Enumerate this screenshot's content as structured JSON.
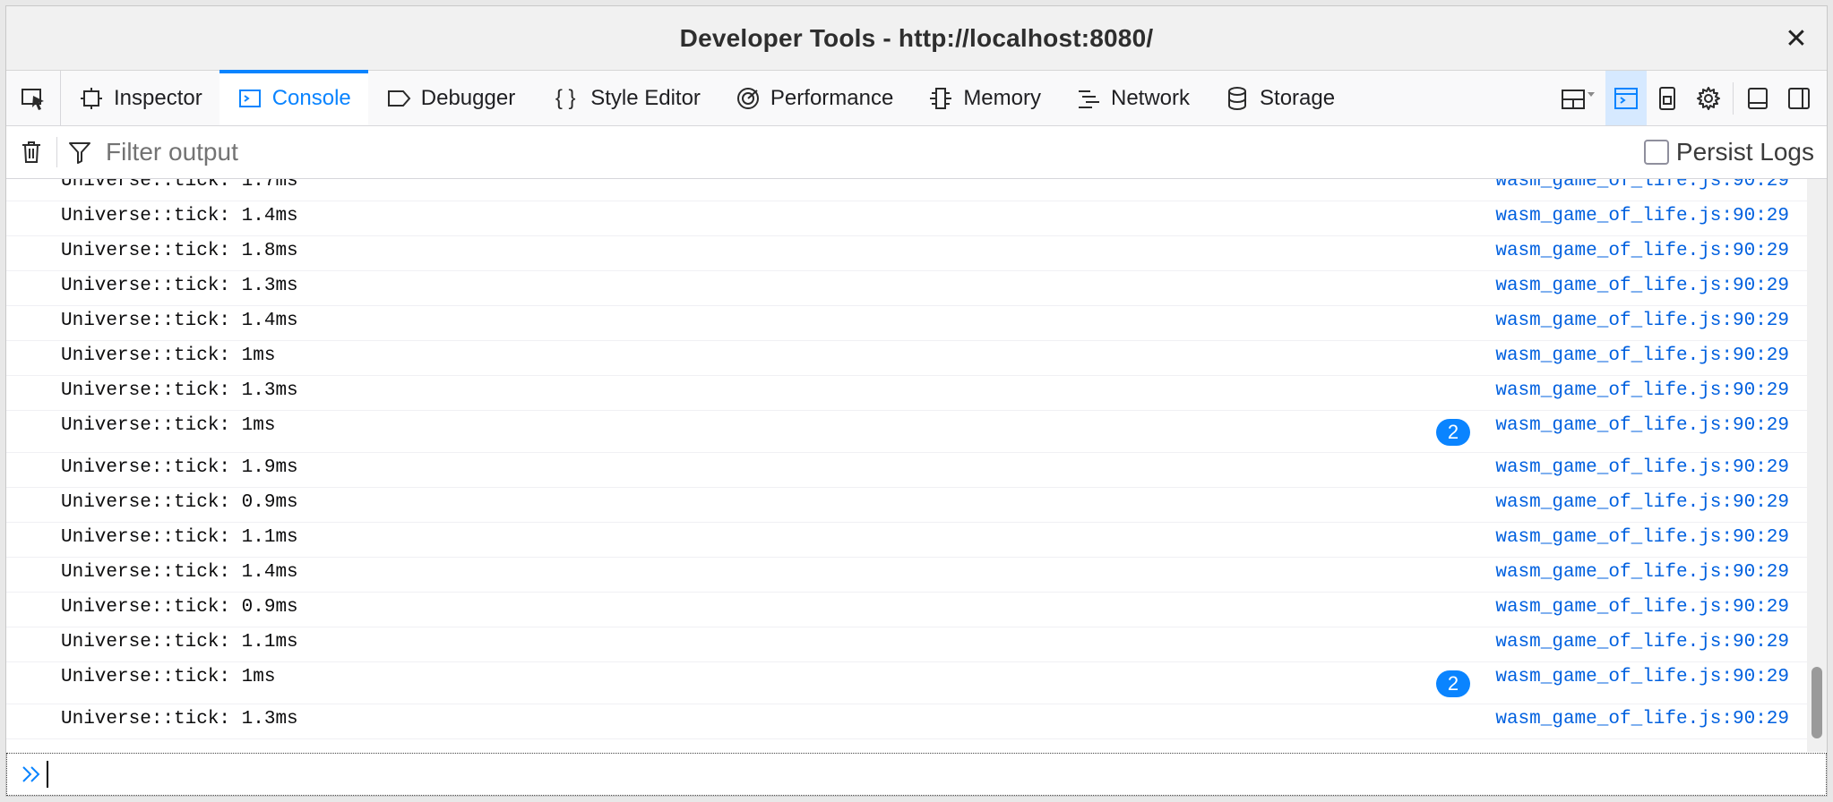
{
  "window": {
    "title": "Developer Tools - http://localhost:8080/",
    "close_glyph": "✕"
  },
  "toolbar": {
    "tabs": [
      {
        "label": "Inspector",
        "icon": "inspector-icon"
      },
      {
        "label": "Console",
        "icon": "console-icon",
        "selected": true
      },
      {
        "label": "Debugger",
        "icon": "debugger-icon"
      },
      {
        "label": "Style Editor",
        "icon": "style-editor-icon"
      },
      {
        "label": "Performance",
        "icon": "performance-icon"
      },
      {
        "label": "Memory",
        "icon": "memory-icon"
      },
      {
        "label": "Network",
        "icon": "network-icon"
      },
      {
        "label": "Storage",
        "icon": "storage-icon"
      }
    ],
    "style_editor_glyph": "{ }",
    "accent_color": "#0a84ff"
  },
  "filter": {
    "placeholder": "Filter output",
    "value": "",
    "persist_logs_label": "Persist Logs",
    "persist_logs_checked": false
  },
  "console": {
    "messages": [
      {
        "text": "Universe::tick: 1.7ms",
        "source": "wasm_game_of_life.js:90:29"
      },
      {
        "text": "Universe::tick: 1.4ms",
        "source": "wasm_game_of_life.js:90:29"
      },
      {
        "text": "Universe::tick: 1.8ms",
        "source": "wasm_game_of_life.js:90:29"
      },
      {
        "text": "Universe::tick: 1.3ms",
        "source": "wasm_game_of_life.js:90:29"
      },
      {
        "text": "Universe::tick: 1.4ms",
        "source": "wasm_game_of_life.js:90:29"
      },
      {
        "text": "Universe::tick: 1ms",
        "source": "wasm_game_of_life.js:90:29"
      },
      {
        "text": "Universe::tick: 1.3ms",
        "source": "wasm_game_of_life.js:90:29"
      },
      {
        "text": "Universe::tick: 1ms",
        "source": "wasm_game_of_life.js:90:29",
        "repeat": "2"
      },
      {
        "text": "Universe::tick: 1.9ms",
        "source": "wasm_game_of_life.js:90:29"
      },
      {
        "text": "Universe::tick: 0.9ms",
        "source": "wasm_game_of_life.js:90:29"
      },
      {
        "text": "Universe::tick: 1.1ms",
        "source": "wasm_game_of_life.js:90:29"
      },
      {
        "text": "Universe::tick: 1.4ms",
        "source": "wasm_game_of_life.js:90:29"
      },
      {
        "text": "Universe::tick: 0.9ms",
        "source": "wasm_game_of_life.js:90:29"
      },
      {
        "text": "Universe::tick: 1.1ms",
        "source": "wasm_game_of_life.js:90:29"
      },
      {
        "text": "Universe::tick: 1ms",
        "source": "wasm_game_of_life.js:90:29",
        "repeat": "2"
      },
      {
        "text": "Universe::tick: 1.3ms",
        "source": "wasm_game_of_life.js:90:29"
      }
    ]
  },
  "jsterm": {
    "value": ""
  }
}
